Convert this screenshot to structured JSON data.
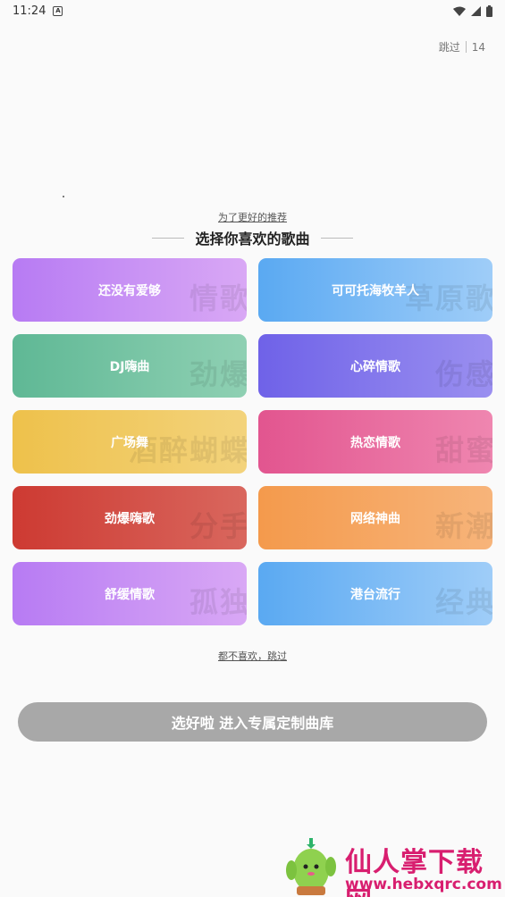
{
  "status": {
    "time": "11:24"
  },
  "header": {
    "skip_label": "跳过",
    "countdown": "14"
  },
  "intro": {
    "subtitle": "为了更好的推荐",
    "title": "选择你喜欢的歌曲"
  },
  "genres": [
    {
      "label": "还没有爱够",
      "watermark": "情歌",
      "gradient": [
        "#b77bf3",
        "#d9a8f5"
      ]
    },
    {
      "label": "可可托海牧羊人",
      "watermark": "草原歌",
      "gradient": [
        "#5aa9f2",
        "#9fcdf8"
      ]
    },
    {
      "label": "DJ嗨曲",
      "watermark": "劲爆",
      "gradient": [
        "#5fb895",
        "#8fd0b3"
      ]
    },
    {
      "label": "心碎情歌",
      "watermark": "伤感",
      "gradient": [
        "#6f62e8",
        "#9a8ff0"
      ]
    },
    {
      "label": "广场舞",
      "watermark": "酒醉蝴蝶",
      "gradient": [
        "#eec14b",
        "#f3d37c"
      ]
    },
    {
      "label": "热恋情歌",
      "watermark": "甜蜜",
      "gradient": [
        "#e2558f",
        "#ef86b0"
      ]
    },
    {
      "label": "劲爆嗨歌",
      "watermark": "分手",
      "gradient": [
        "#cd3a32",
        "#d9675e"
      ]
    },
    {
      "label": "网络神曲",
      "watermark": "新潮",
      "gradient": [
        "#f49a4c",
        "#f7b47a"
      ]
    },
    {
      "label": "舒缓情歌",
      "watermark": "孤独",
      "gradient": [
        "#b77bf3",
        "#d9a8f5"
      ]
    },
    {
      "label": "港台流行",
      "watermark": "经典",
      "gradient": [
        "#5aa9f2",
        "#9fcdf8"
      ]
    }
  ],
  "footer": {
    "no_like_label": "都不喜欢，跳过",
    "confirm_label": "选好啦 进入专属定制曲库"
  },
  "site_watermark": {
    "title": "仙人掌下载网",
    "url": "www.hebxqrc.com"
  }
}
